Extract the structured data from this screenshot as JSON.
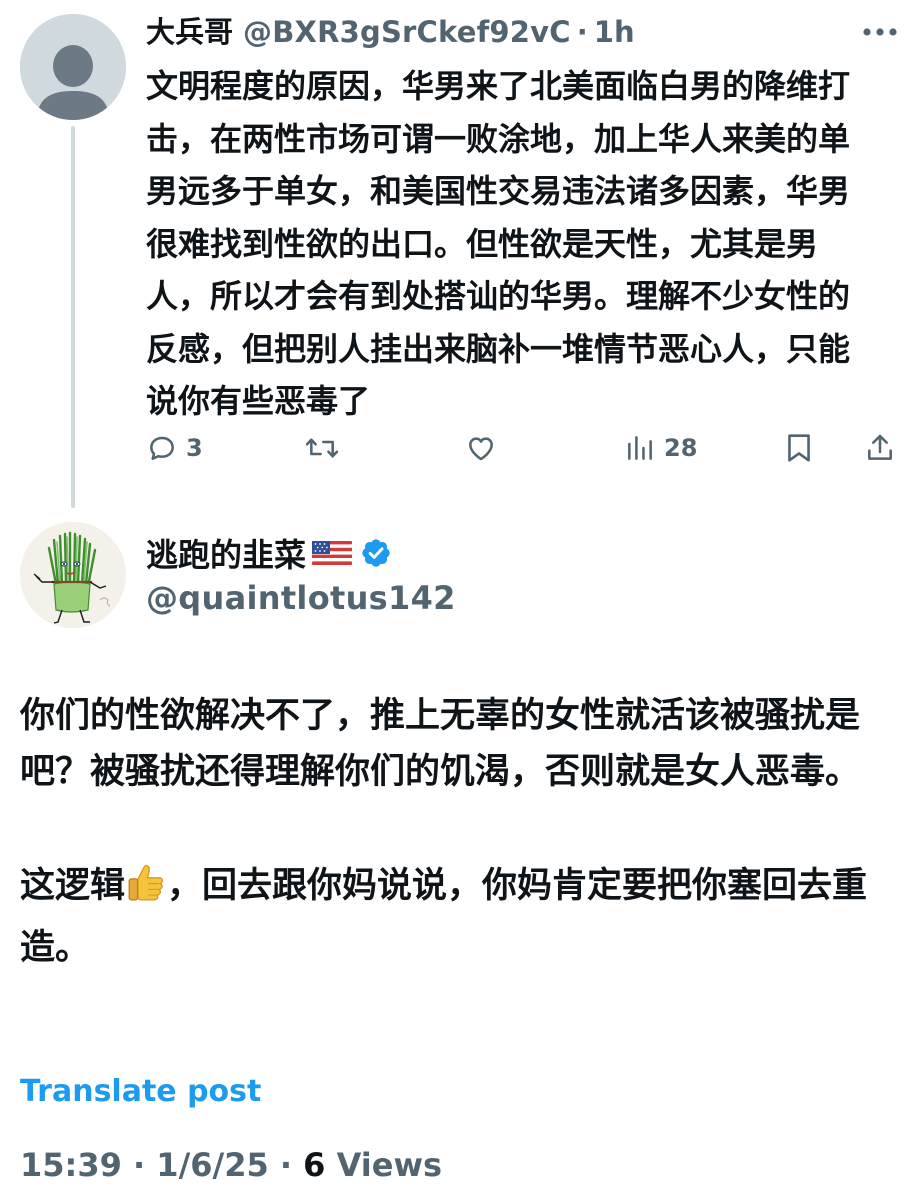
{
  "reply": {
    "author": {
      "display_name": "大兵哥",
      "handle": "@BXR3gSrCkef92vC",
      "separator": "·",
      "time": "1h",
      "avatar": "default-avatar-icon"
    },
    "text": "文明程度的原因，华男来了北美面临白男的降维打击，在两性市场可谓一败涂地，加上华人来美的单男远多于单女，和美国性交易违法诸多因素，华男很难找到性欲的出口。但性欲是天性，尤其是男人，所以才会有到处搭讪的华男。理解不少女性的反感，但把别人挂出来脑补一堆情节恶心人，只能说你有些恶毒了",
    "actions": {
      "reply_count": "3",
      "retweet_count": "",
      "like_count": "",
      "views_count": "28"
    }
  },
  "tweet": {
    "author": {
      "display_name": "逃跑的韭菜",
      "flag": "🇺🇸",
      "verified": true,
      "handle": "@quaintlotus142"
    },
    "paragraph_1": "你们的性欲解决不了，推上无辜的女性就活该被骚扰是吧？被骚扰还得理解你们的饥渴，否则就是女人恶毒。",
    "paragraph_2_before": "这逻辑",
    "paragraph_2_emoji": "👍",
    "paragraph_2_after": "，回去跟你妈说说，你妈肯定要把你塞回去重造。",
    "translate_label": "Translate post",
    "time": "15:39",
    "date": "1/6/25",
    "views_count": "6",
    "views_label": "Views",
    "meta_separator": " · "
  },
  "colors": {
    "text_primary": "#0f1419",
    "text_secondary": "#536471",
    "accent": "#1d9bf0",
    "thread_line": "#cfd9de"
  }
}
